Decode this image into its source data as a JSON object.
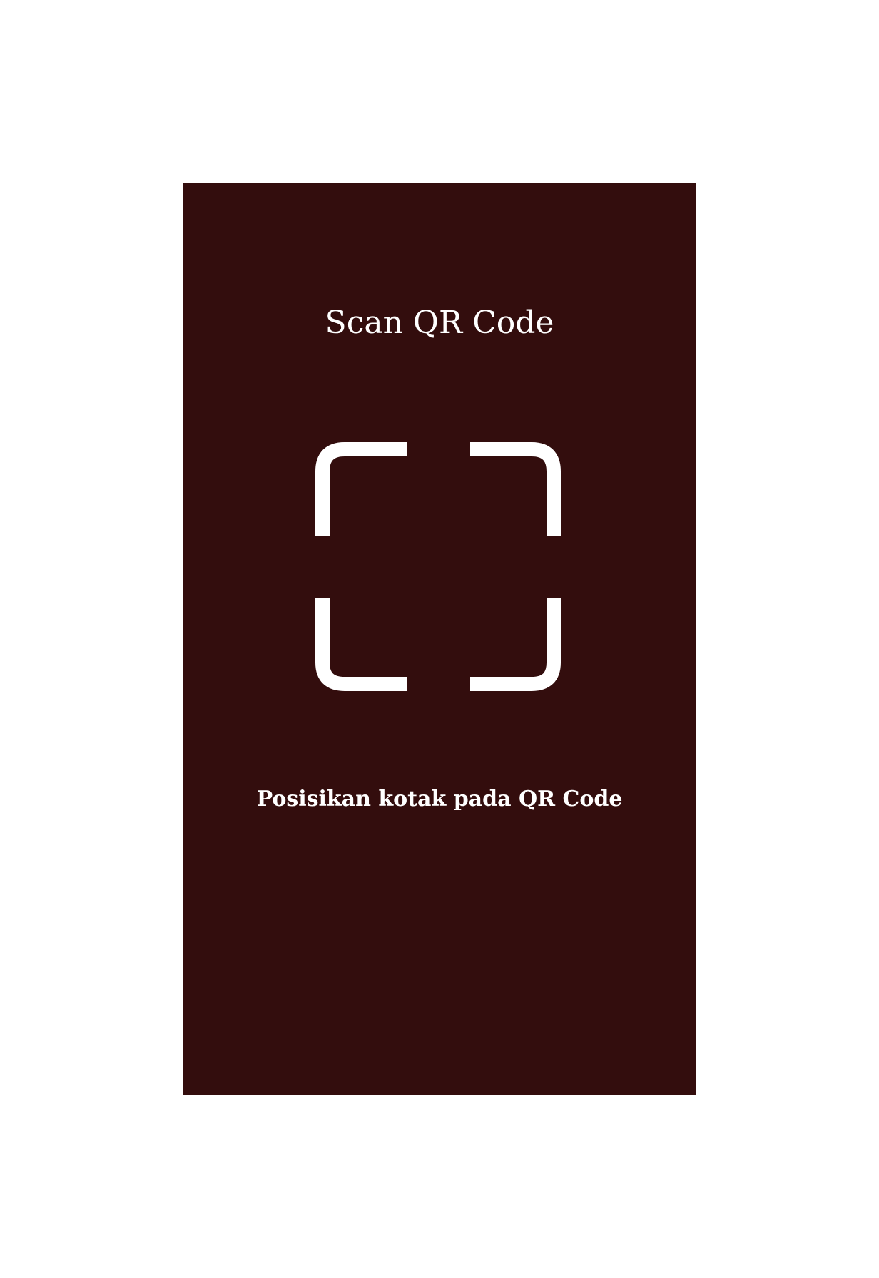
{
  "screen": {
    "title": "Scan QR Code",
    "hint": "Posisikan kotak pada QR Code",
    "background_color": "#330d0d",
    "foreground_color": "#ffffff"
  },
  "scanner": {
    "icon": "qr-scan-frame-icon"
  }
}
